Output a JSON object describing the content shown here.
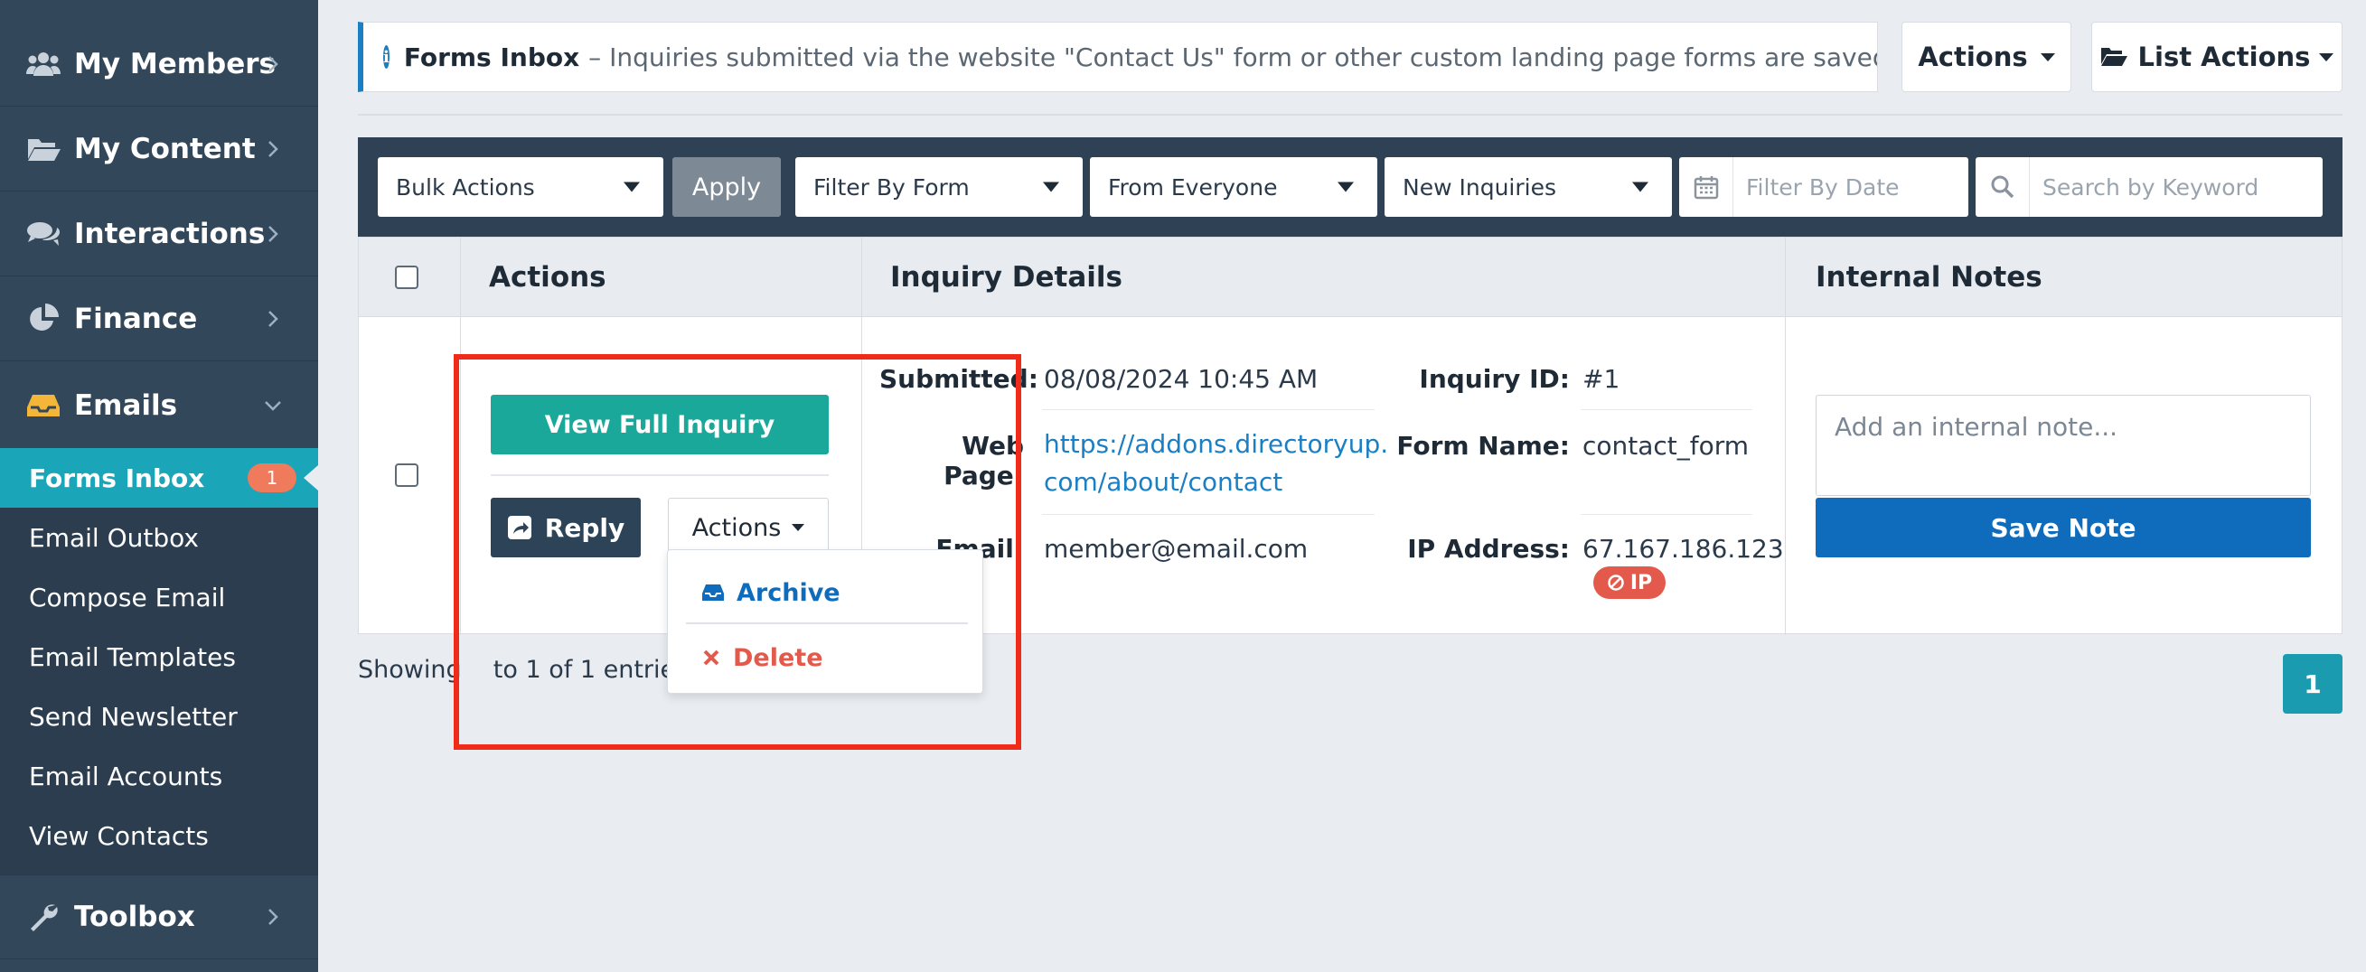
{
  "sidebar": {
    "items": [
      {
        "label": "My Members",
        "icon": "users-icon"
      },
      {
        "label": "My Content",
        "icon": "folder-open-icon"
      },
      {
        "label": "Interactions",
        "icon": "comments-icon"
      },
      {
        "label": "Finance",
        "icon": "pie-chart-icon"
      },
      {
        "label": "Emails",
        "icon": "inbox-icon"
      },
      {
        "label": "Toolbox",
        "icon": "wrench-icon"
      }
    ],
    "email_subitems": [
      {
        "label": "Forms Inbox",
        "badge": "1"
      },
      {
        "label": "Email Outbox"
      },
      {
        "label": "Compose Email"
      },
      {
        "label": "Email Templates"
      },
      {
        "label": "Send Newsletter"
      },
      {
        "label": "Email Accounts"
      },
      {
        "label": "View Contacts"
      }
    ]
  },
  "header": {
    "info_title": "Forms Inbox",
    "info_text": "– Inquiries submitted via the website \"Contact Us\" form or other custom landing page forms are saved here",
    "actions_label": "Actions",
    "list_actions_label": "List Actions"
  },
  "filters": {
    "bulk_actions": "Bulk Actions",
    "apply": "Apply",
    "filter_by_form": "Filter By Form",
    "from": "From Everyone",
    "status": "New Inquiries",
    "date_placeholder": "Filter By Date",
    "search_placeholder": "Search by Keyword"
  },
  "table": {
    "headers": [
      "Actions",
      "Inquiry Details",
      "Internal Notes"
    ],
    "row": {
      "view_full": "View Full Inquiry",
      "reply": "Reply",
      "actions": "Actions",
      "dropdown": {
        "archive": "Archive",
        "delete": "Delete"
      },
      "submitted_label": "Submitted:",
      "submitted_value": "08/08/2024 10:45 AM",
      "inquiry_id_label": "Inquiry ID:",
      "inquiry_id_value": "#1",
      "web_page_label": "Web Page:",
      "web_page_value_line1": "https://addons.directoryup.",
      "web_page_value_line2": "com/about/contact",
      "form_name_label": "Form Name:",
      "form_name_value": "contact_form",
      "email_label": "Email:",
      "email_value": "member@email.com",
      "ip_label": "IP Address:",
      "ip_value": "67.167.186.123",
      "ip_badge": "IP",
      "note_placeholder": "Add an internal note...",
      "save_note": "Save Note"
    }
  },
  "footer": {
    "showing_prefix": "Showing",
    "showing_suffix": "to 1 of 1 entries",
    "page": "1"
  },
  "colors": {
    "sidebar": "#33475b",
    "active": "#1aa5b9",
    "teal_button": "#1aa89a",
    "save_button": "#0f6cbd",
    "danger": "#e35a4d",
    "highlight": "#f12b1a"
  }
}
